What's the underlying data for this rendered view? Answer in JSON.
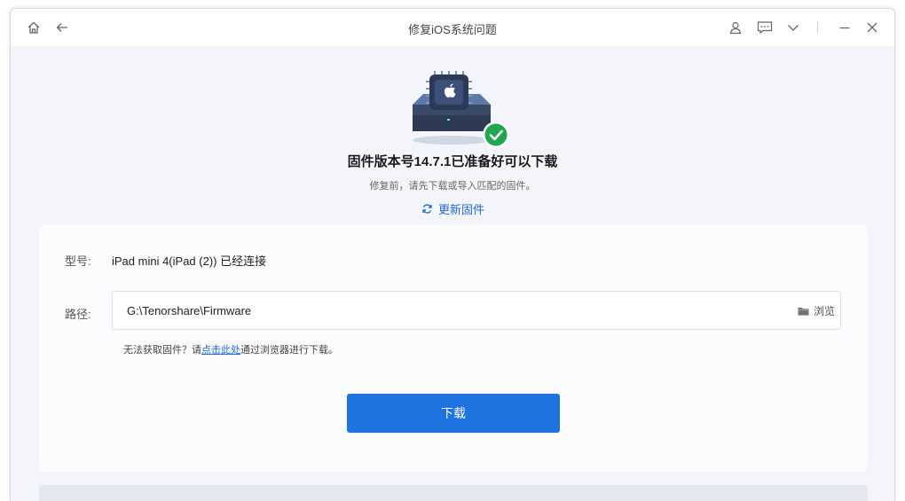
{
  "window": {
    "title": "修复iOS系统问题"
  },
  "titlebar": {
    "icons": [
      "home-icon",
      "back-arrow-icon",
      "user-icon",
      "feedback-icon",
      "chevron-down-icon",
      "minimize-icon",
      "close-icon"
    ]
  },
  "hero": {
    "icons": [
      "chip-device-icon",
      "check-circle-icon"
    ],
    "heading": "固件版本号14.7.1已准备好可以下载",
    "subtext": "修复前，请先下载或导入匹配的固件。",
    "update_label": "更新固件"
  },
  "form": {
    "model_label": "型号:",
    "model_value": "iPad mini 4(iPad (2)) 已经连接",
    "path_label": "路径:",
    "path_value": "G:\\Tenorshare\\Firmware",
    "browse_label": "浏览",
    "hint_prefix": "无法获取固件？请",
    "hint_link": "点击此处",
    "hint_suffix": "通过浏览器进行下载。"
  },
  "download_button": "下载",
  "colors": {
    "accent": "#1f73e0",
    "link": "#1e6ad6",
    "success": "#22a651"
  }
}
